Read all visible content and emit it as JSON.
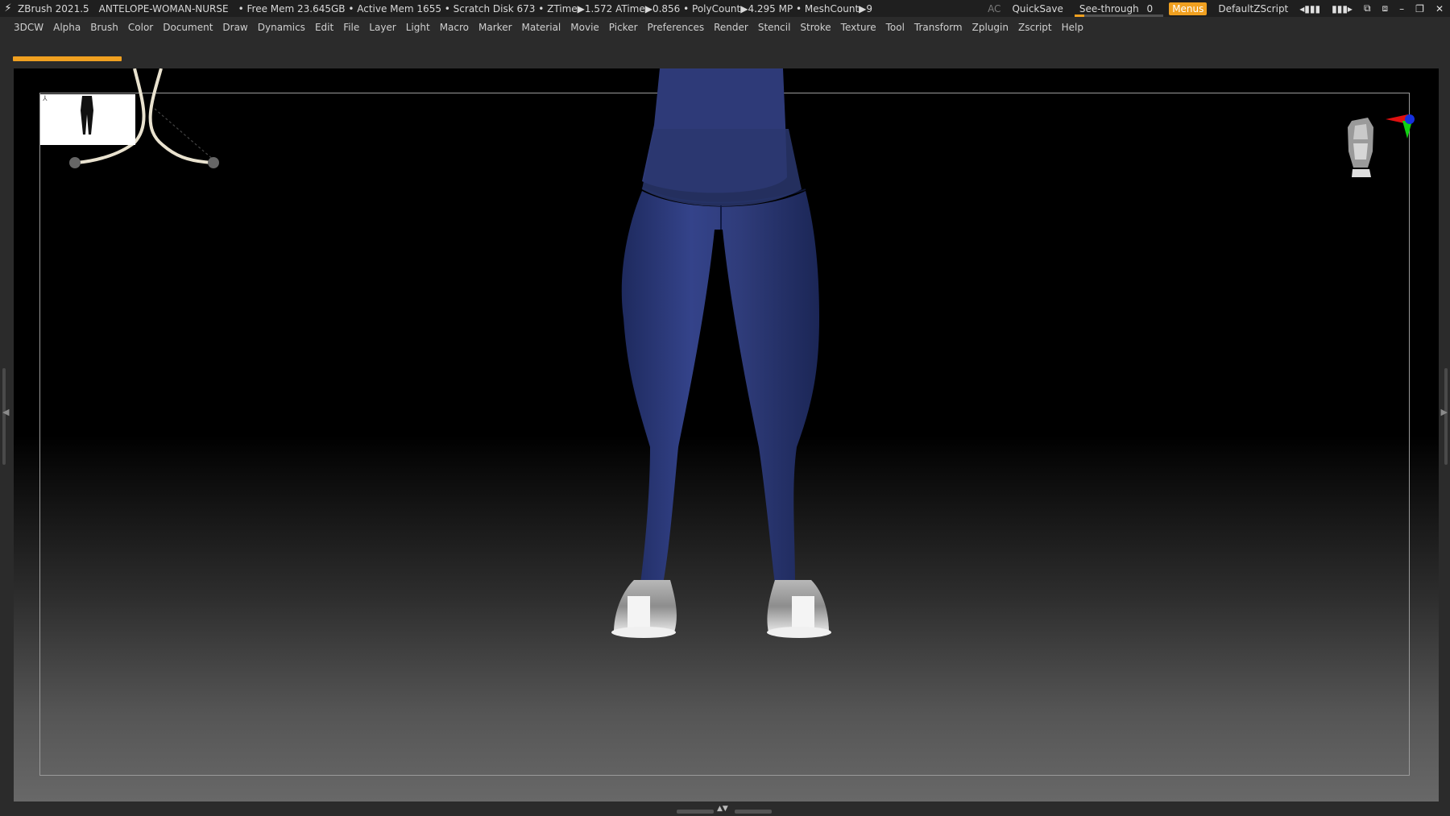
{
  "titlebar": {
    "app_name": "ZBrush 2021.5",
    "project": "ANTELOPE-WOMAN-NURSE",
    "stats": "• Free Mem 23.645GB • Active Mem 1655 • Scratch Disk 673 • ZTime▶1.572 ATime▶0.856 • PolyCount▶4.295 MP • MeshCount▶9",
    "ac": "AC",
    "quicksave": "QuickSave",
    "seethrough_label": "See-through",
    "seethrough_value": "0",
    "menus": "Menus",
    "script": "DefaultZScript"
  },
  "menu": [
    "3DCW",
    "Alpha",
    "Brush",
    "Color",
    "Document",
    "Draw",
    "Dynamics",
    "Edit",
    "File",
    "Layer",
    "Light",
    "Macro",
    "Marker",
    "Material",
    "Movie",
    "Picker",
    "Preferences",
    "Render",
    "Stencil",
    "Stroke",
    "Texture",
    "Tool",
    "Transform",
    "Zplugin",
    "Zscript",
    "Help"
  ],
  "colors": {
    "accent": "#f0a020",
    "scrubs": "#2f3c7a",
    "shoe": "#e8e8e8"
  },
  "progress_fraction": 1.0
}
